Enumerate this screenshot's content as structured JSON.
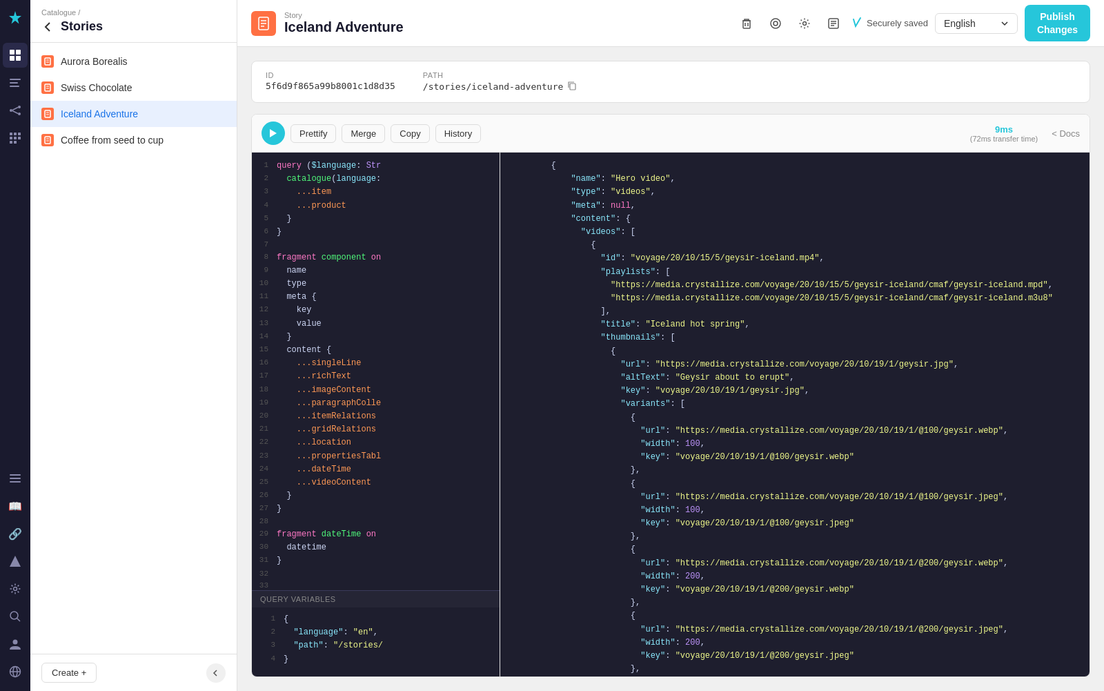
{
  "app": {
    "logo_text": "✦"
  },
  "iconbar": {
    "icons": [
      {
        "name": "catalogue-icon",
        "symbol": "⊞",
        "active": true
      },
      {
        "name": "content-icon",
        "symbol": "≡"
      },
      {
        "name": "relations-icon",
        "symbol": "⛓"
      },
      {
        "name": "grid-icon",
        "symbol": "▦"
      },
      {
        "name": "list-icon",
        "symbol": "☰"
      },
      {
        "name": "book-icon",
        "symbol": "📖"
      },
      {
        "name": "link-icon",
        "symbol": "🔗"
      },
      {
        "name": "shapes-icon",
        "symbol": "⬡"
      },
      {
        "name": "settings-icon",
        "symbol": "⚙"
      },
      {
        "name": "search-icon",
        "symbol": "🔍"
      },
      {
        "name": "user-icon",
        "symbol": "👤"
      },
      {
        "name": "globe-icon",
        "symbol": "🌐"
      }
    ]
  },
  "sidebar": {
    "breadcrumb": "Catalogue /",
    "title": "Stories",
    "items": [
      {
        "label": "Aurora Borealis",
        "id": "aurora-borealis",
        "active": false
      },
      {
        "label": "Swiss Chocolate",
        "id": "swiss-chocolate",
        "active": false
      },
      {
        "label": "Iceland Adventure",
        "id": "iceland-adventure",
        "active": true
      },
      {
        "label": "Coffee from seed to cup",
        "id": "coffee-seed-cup",
        "active": false
      }
    ],
    "create_label": "Create +"
  },
  "topbar": {
    "story_label": "Story",
    "story_name": "Iceland Adventure",
    "saved_status": "Securely saved",
    "language": "English",
    "publish_label": "Publish\nChanges"
  },
  "meta": {
    "id_label": "ID",
    "id_value": "5f6d9f865a99b8001c1d8d35",
    "path_label": "Path",
    "path_value": "/stories/iceland-adventure"
  },
  "query": {
    "prettify_label": "Prettify",
    "merge_label": "Merge",
    "copy_label": "Copy",
    "history_label": "History",
    "timing_ms": "9ms",
    "timing_transfer": "(72ms transfer time)",
    "docs_label": "< Docs",
    "query_variables_label": "QUERY VARIABLES"
  },
  "response": {
    "content": "response JSON data"
  }
}
